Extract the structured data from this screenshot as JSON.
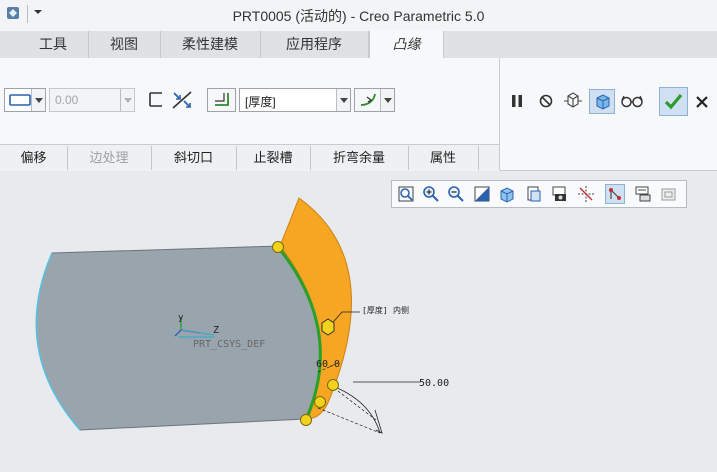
{
  "window": {
    "title": "PRT0005 (活动的) - Creo Parametric 5.0"
  },
  "tabs": [
    {
      "label": "工具"
    },
    {
      "label": "视图"
    },
    {
      "label": "柔性建模"
    },
    {
      "label": "应用程序"
    },
    {
      "label": "凸缘",
      "active": true
    }
  ],
  "ribbon": {
    "shape_icon": "flange-shape-icon",
    "length_value": "0.00",
    "thickness_value": "[厚度]",
    "right_buttons": [
      "pause-icon",
      "no-preview-icon",
      "verify-icon",
      "preview-icon",
      "glasses-icon",
      "ok-check-icon",
      "cancel-x-icon"
    ]
  },
  "subtabs": [
    {
      "label": "偏移"
    },
    {
      "label": "边处理",
      "disabled": true
    },
    {
      "label": "斜切口"
    },
    {
      "label": "止裂槽"
    },
    {
      "label": "折弯余量"
    },
    {
      "label": "属性"
    }
  ],
  "viewport": {
    "csys_label": "PRT_CSYS_DEF",
    "csys_axis_z": "Z",
    "annotation_thickness": "[厚度]",
    "annotation_side": "内侧",
    "dim_angle": "60.0",
    "dim_value": "50.00"
  },
  "colors": {
    "accent": "#f6a623",
    "part_gray": "#9aa4ad",
    "edge_green": "#27a12a",
    "handle_yellow": "#f3d21b",
    "ok_green": "#2d9b2d"
  }
}
